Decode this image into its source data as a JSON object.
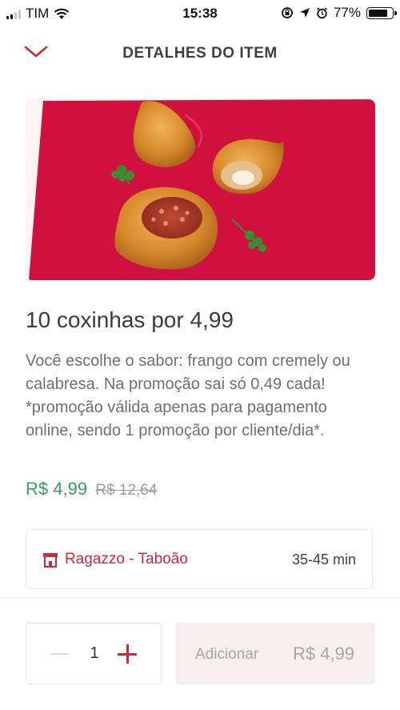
{
  "status_bar": {
    "carrier": "TIM",
    "time": "15:38",
    "battery": "77%"
  },
  "header": {
    "title": "DETALHES DO ITEM",
    "back_icon": "chevron-down-icon"
  },
  "item": {
    "image_icon": "coxinha-photo",
    "title": "10 coxinhas por 4,99",
    "description": "Você escolhe o sabor: frango com cremely ou calabresa. Na promoção sai só 0,49 cada! *promoção válida apenas para pagamento online, sendo 1 promoção por cliente/dia*.",
    "price": "R$ 4,99",
    "old_price": "R$ 12,64"
  },
  "store": {
    "icon": "store-icon",
    "name": "Ragazzo - Taboão",
    "delivery_time": "35-45 min"
  },
  "order": {
    "quantity": "1",
    "add_label": "Adicionar",
    "add_price": "R$ 4,99"
  },
  "colors": {
    "accent": "#d0283b",
    "price_green": "#3a9a5f",
    "hero_bg": "#d0103f"
  }
}
